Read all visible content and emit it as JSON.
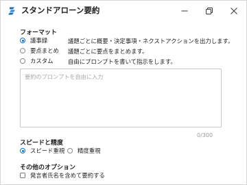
{
  "window": {
    "title": "スタンドアローン要約"
  },
  "icons": {
    "app": "app-logo-icon",
    "minimize": "minimize-icon",
    "maximize": "restore-icon",
    "close": "close-icon"
  },
  "format": {
    "label": "フォーマット",
    "options": [
      {
        "label": "議事録",
        "desc": "議題ごとに概要・決定事項・ネクストアクションを出力します。",
        "selected": true
      },
      {
        "label": "要点まとめ",
        "desc": "議題ごとに要点をまとめます。",
        "selected": false
      },
      {
        "label": "カスタム",
        "desc": "自由にプロンプトを書いて指示をします。",
        "selected": false
      }
    ]
  },
  "prompt": {
    "placeholder": "要約のプロンプトを自由に入力",
    "value": "",
    "counter": "0/300"
  },
  "speed": {
    "label": "スピードと精度",
    "options": [
      {
        "label": "スピード重視",
        "selected": true
      },
      {
        "label": "精度重視",
        "selected": false
      }
    ]
  },
  "other": {
    "label": "その他のオプション",
    "include_speaker_label": "発言者氏名を含めて要約する",
    "include_speaker_checked": false
  },
  "colors": {
    "accent": "#0f6cbd",
    "app_icon": "#1f6fb5"
  }
}
